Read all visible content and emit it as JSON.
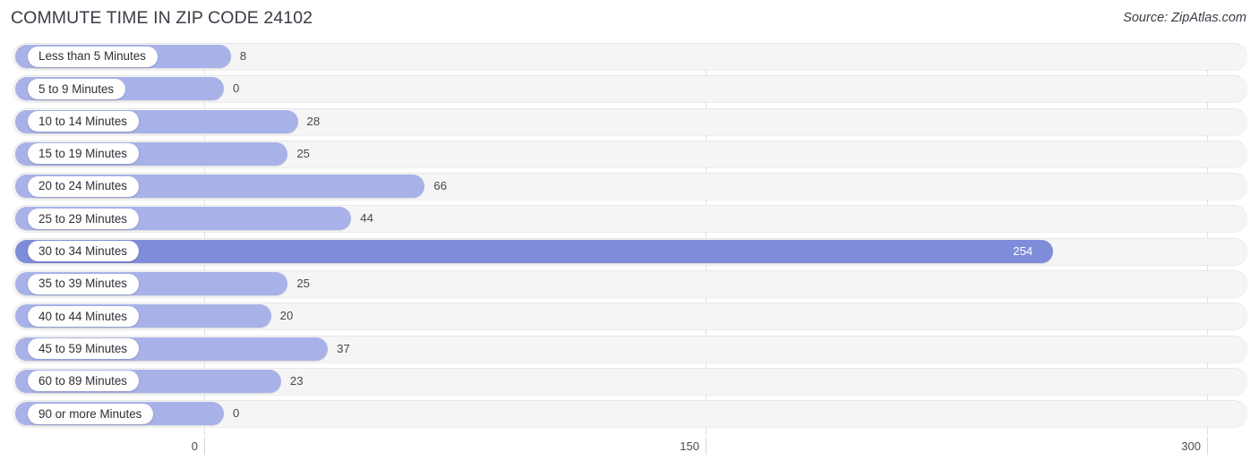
{
  "header": {
    "title": "COMMUTE TIME IN ZIP CODE 24102",
    "source": "Source: ZipAtlas.com"
  },
  "colors": {
    "bar": "#a8b2e8",
    "bar_highlight": "#7e8cd9",
    "track": "#f5f5f5",
    "gridline": "#e3e3e3",
    "text": "#3b3b46",
    "value_inside": "#ffffff"
  },
  "chart_data": {
    "type": "bar",
    "orientation": "horizontal",
    "title": "COMMUTE TIME IN ZIP CODE 24102",
    "xlabel": "",
    "ylabel": "",
    "xlim": [
      0,
      300
    ],
    "xticks": [
      0,
      150,
      300
    ],
    "xtick_labels": [
      "0",
      "150",
      "300"
    ],
    "grid": true,
    "legend": false,
    "categories": [
      "Less than 5 Minutes",
      "5 to 9 Minutes",
      "10 to 14 Minutes",
      "15 to 19 Minutes",
      "20 to 24 Minutes",
      "25 to 29 Minutes",
      "30 to 34 Minutes",
      "35 to 39 Minutes",
      "40 to 44 Minutes",
      "45 to 59 Minutes",
      "60 to 89 Minutes",
      "90 or more Minutes"
    ],
    "values": [
      8,
      0,
      28,
      25,
      66,
      44,
      254,
      25,
      20,
      37,
      23,
      0
    ],
    "value_labels": [
      "8",
      "0",
      "28",
      "25",
      "66",
      "44",
      "254",
      "25",
      "20",
      "37",
      "23",
      "0"
    ],
    "highlight_index": 6
  }
}
